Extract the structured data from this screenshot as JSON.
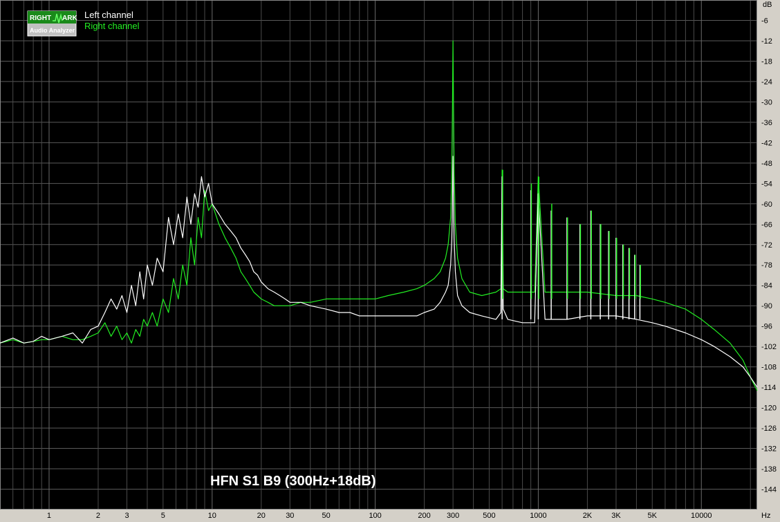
{
  "chart_data": {
    "type": "line",
    "x_scale": "log",
    "xlim": [
      0.5,
      22000
    ],
    "ylim": [
      -150,
      0
    ],
    "grid": true,
    "y_unit": "dB",
    "x_unit": "Hz",
    "y_ticks": [
      -6,
      -12,
      -18,
      -24,
      -30,
      -36,
      -42,
      -48,
      -54,
      -60,
      -66,
      -72,
      -78,
      -84,
      -90,
      -96,
      -102,
      -108,
      -114,
      -120,
      -126,
      -132,
      -138,
      -144
    ],
    "x_ticks": [
      {
        "value": 1,
        "label": "1"
      },
      {
        "value": 2,
        "label": "2"
      },
      {
        "value": 3,
        "label": "3"
      },
      {
        "value": 5,
        "label": "5"
      },
      {
        "value": 10,
        "label": "10"
      },
      {
        "value": 20,
        "label": "20"
      },
      {
        "value": 30,
        "label": "30"
      },
      {
        "value": 50,
        "label": "50"
      },
      {
        "value": 100,
        "label": "100"
      },
      {
        "value": 200,
        "label": "200"
      },
      {
        "value": 300,
        "label": "300"
      },
      {
        "value": 500,
        "label": "500"
      },
      {
        "value": 1000,
        "label": "1000"
      },
      {
        "value": 2000,
        "label": "2K"
      },
      {
        "value": 3000,
        "label": "3K"
      },
      {
        "value": 5000,
        "label": "5K"
      },
      {
        "value": 10000,
        "label": "10000"
      }
    ],
    "legend": [
      {
        "name": "Left channel",
        "color": "#ffffff"
      },
      {
        "name": "Right channel",
        "color": "#22ee22"
      }
    ],
    "annotation": "HFN S1 B9 (300Hz+18dB)",
    "logo": {
      "line1a": "RIGHT",
      "line1b": "ARK",
      "line2": "Audio Analyzer"
    },
    "series": [
      {
        "name": "Left channel",
        "color": "#ffffff",
        "x": [
          0.5,
          0.6,
          0.7,
          0.8,
          0.9,
          1.0,
          1.2,
          1.4,
          1.6,
          1.8,
          2.0,
          2.2,
          2.4,
          2.6,
          2.8,
          3.0,
          3.2,
          3.4,
          3.6,
          3.8,
          4.0,
          4.3,
          4.6,
          5.0,
          5.4,
          5.8,
          6.2,
          6.6,
          7.0,
          7.4,
          7.8,
          8.2,
          8.6,
          9.0,
          9.5,
          10,
          11,
          12,
          13,
          14,
          15,
          16,
          17,
          18,
          19,
          20,
          22,
          24,
          26,
          28,
          30,
          35,
          40,
          50,
          60,
          70,
          80,
          100,
          120,
          150,
          180,
          200,
          230,
          250,
          270,
          280,
          290,
          295,
          298,
          300,
          302,
          305,
          310,
          320,
          340,
          380,
          450,
          550,
          590,
          600,
          610,
          650,
          800,
          900,
          950,
          1000,
          1100,
          1300,
          1500,
          2000,
          3000,
          4000,
          5000,
          6000,
          8000,
          10000,
          12000,
          15000,
          18000,
          20000,
          22000
        ],
        "y": [
          -101,
          -99.5,
          -101,
          -100.5,
          -99,
          -100,
          -99,
          -98,
          -101,
          -97,
          -96,
          -92,
          -88,
          -91,
          -87,
          -92,
          -84,
          -90,
          -80,
          -88,
          -78,
          -84,
          -76,
          -80,
          -64,
          -72,
          -63,
          -70,
          -58,
          -66,
          -57,
          -61,
          -52,
          -58,
          -54,
          -60,
          -63,
          -66,
          -68,
          -70,
          -73,
          -75,
          -77,
          -80,
          -81,
          -83,
          -85,
          -86,
          -87,
          -88,
          -89,
          -89,
          -90,
          -91,
          -92,
          -92,
          -93,
          -93,
          -93,
          -93,
          -93,
          -92,
          -91,
          -89,
          -86,
          -84,
          -78,
          -70,
          -58,
          -46,
          -58,
          -70,
          -80,
          -87,
          -90,
          -92,
          -93,
          -94,
          -92,
          -52,
          -91,
          -94,
          -95,
          -95,
          -95,
          -57,
          -94,
          -94,
          -94,
          -93,
          -93,
          -94,
          -95,
          -96,
          -98,
          -100,
          -102,
          -105,
          -108,
          -111,
          -114
        ]
      },
      {
        "name": "Right channel",
        "color": "#22ee22",
        "x": [
          0.5,
          0.6,
          0.7,
          0.8,
          0.9,
          1.0,
          1.2,
          1.4,
          1.6,
          1.8,
          2.0,
          2.2,
          2.4,
          2.6,
          2.8,
          3.0,
          3.2,
          3.4,
          3.6,
          3.8,
          4.0,
          4.3,
          4.6,
          5.0,
          5.4,
          5.8,
          6.2,
          6.6,
          7.0,
          7.4,
          7.8,
          8.2,
          8.6,
          9.0,
          9.5,
          10,
          11,
          12,
          13,
          14,
          15,
          16,
          17,
          18,
          19,
          20,
          22,
          24,
          26,
          28,
          30,
          35,
          40,
          50,
          60,
          70,
          80,
          100,
          120,
          150,
          180,
          200,
          230,
          250,
          270,
          280,
          290,
          295,
          298,
          300,
          302,
          305,
          310,
          320,
          340,
          380,
          450,
          550,
          590,
          600,
          610,
          650,
          800,
          900,
          950,
          1000,
          1100,
          1300,
          1500,
          2000,
          3000,
          4000,
          5000,
          6000,
          8000,
          10000,
          12000,
          15000,
          18000,
          20000,
          22000
        ],
        "y": [
          -101,
          -100,
          -101,
          -100.5,
          -100,
          -100,
          -99,
          -100,
          -100,
          -99,
          -98,
          -95,
          -99,
          -96,
          -100,
          -98,
          -101,
          -97,
          -99,
          -94,
          -96,
          -92,
          -96,
          -88,
          -92,
          -82,
          -88,
          -78,
          -84,
          -70,
          -78,
          -64,
          -70,
          -56,
          -62,
          -60,
          -66,
          -70,
          -73,
          -76,
          -80,
          -82,
          -84,
          -86,
          -87,
          -88,
          -89,
          -90,
          -90,
          -90,
          -90,
          -89,
          -89,
          -88,
          -88,
          -88,
          -88,
          -88,
          -87,
          -86,
          -85,
          -84,
          -82,
          -80,
          -76,
          -72,
          -64,
          -50,
          -30,
          -12,
          -30,
          -50,
          -66,
          -76,
          -82,
          -86,
          -87,
          -86,
          -85,
          -50,
          -85,
          -86,
          -86,
          -86,
          -86,
          -52,
          -86,
          -86,
          -86,
          -86,
          -87,
          -87,
          -88,
          -89,
          -91,
          -94,
          -97,
          -101,
          -106,
          -111,
          -115
        ]
      }
    ],
    "harmonics": [
      {
        "freq": 600,
        "left": -52,
        "right": -50
      },
      {
        "freq": 900,
        "left": -56,
        "right": -54
      },
      {
        "freq": 1000,
        "left": -57,
        "right": -52
      },
      {
        "freq": 1200,
        "left": -62,
        "right": -60
      },
      {
        "freq": 1500,
        "left": -64,
        "right": -64
      },
      {
        "freq": 1800,
        "left": -66,
        "right": -66
      },
      {
        "freq": 2100,
        "left": -62,
        "right": -62
      },
      {
        "freq": 2400,
        "left": -66,
        "right": -66
      },
      {
        "freq": 2700,
        "left": -68,
        "right": -68
      },
      {
        "freq": 3000,
        "left": -70,
        "right": -70
      },
      {
        "freq": 3300,
        "left": -72,
        "right": -72
      },
      {
        "freq": 3600,
        "left": -73,
        "right": -73
      },
      {
        "freq": 3900,
        "left": -75,
        "right": -75
      },
      {
        "freq": 4200,
        "left": -78,
        "right": -78
      }
    ]
  }
}
